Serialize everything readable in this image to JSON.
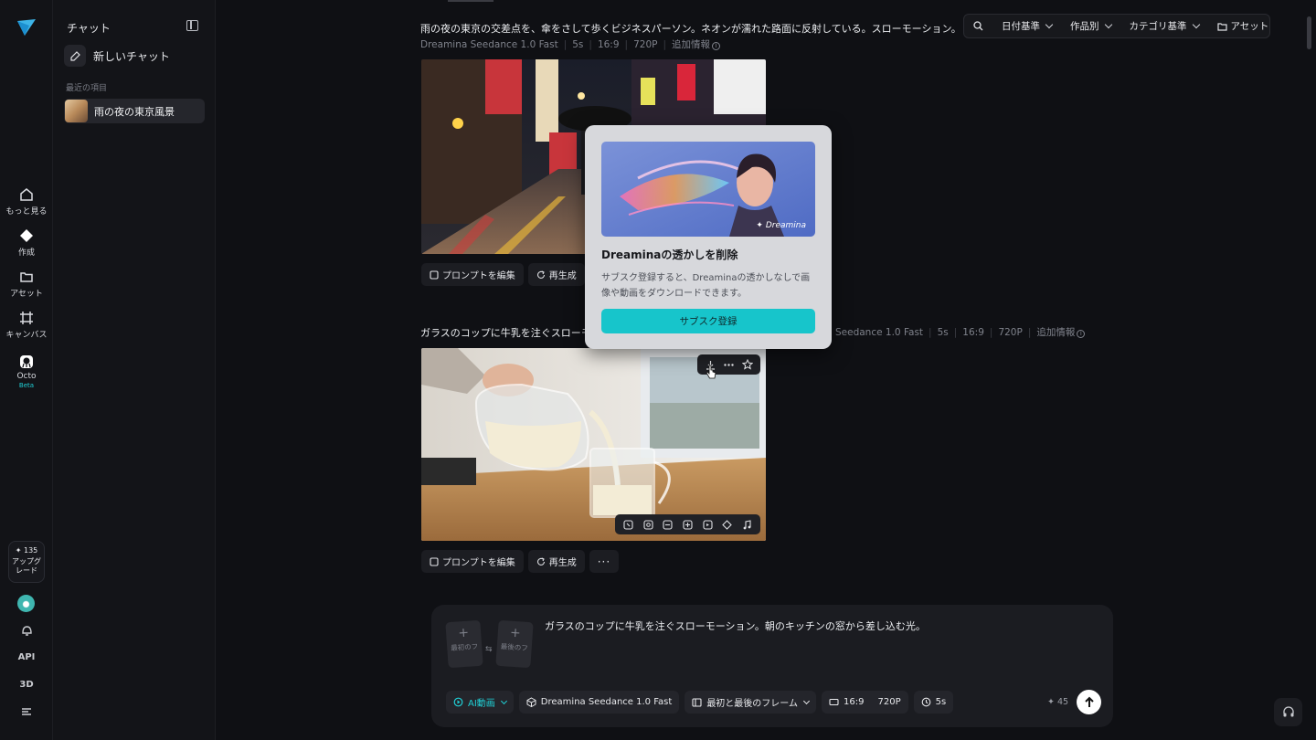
{
  "colors": {
    "accent": "#17c5cb",
    "background": "#0f1014",
    "panel": "#1b1c21"
  },
  "rail": {
    "items": [
      {
        "label": "もっと見る",
        "icon": "home-icon"
      },
      {
        "label": "作成",
        "icon": "create-icon"
      },
      {
        "label": "アセット",
        "icon": "folder-icon"
      },
      {
        "label": "キャンバス",
        "icon": "canvas-icon"
      },
      {
        "label": "Octo",
        "icon": "octo-icon",
        "badge": "Beta"
      }
    ],
    "credits": "135",
    "upgrade_label": "アップグレード",
    "api_label": "API",
    "three_d_label": "3D"
  },
  "sidebar": {
    "title": "チャット",
    "new_chat": "新しいチャット",
    "section": "最近の項目",
    "recent": [
      {
        "label": "雨の夜の東京風景"
      }
    ]
  },
  "toolbar": {
    "date": "日付基準",
    "by_work": "作品別",
    "category": "カテゴリ基準",
    "assets": "アセット"
  },
  "feed": [
    {
      "prompt": "雨の夜の東京の交差点を、傘をさして歩くビジネスパーソン。ネオンが濡れた路面に反射している。スローモーション。",
      "model": "Dreamina Seedance 1.0 Fast",
      "duration": "5s",
      "ratio": "16:9",
      "resolution": "720P",
      "more": "追加情報",
      "edit": "プロンプトを編集",
      "regen": "再生成"
    },
    {
      "prompt": "ガラスのコップに牛乳を注ぐスローモー",
      "model": "Seedance 1.0 Fast",
      "duration": "5s",
      "ratio": "16:9",
      "resolution": "720P",
      "more": "追加情報",
      "edit": "プロンプトを編集",
      "regen": "再生成",
      "more_actions": "···"
    }
  ],
  "popup": {
    "brand": "Dreamina",
    "title": "Dreaminaの透かしを削除",
    "body": "サブスク登録すると、Dreaminaの透かしなしで画像や動画をダウンロードできます。",
    "cta": "サブスク登録"
  },
  "composer": {
    "first_frame": "最初のフ",
    "last_frame": "最後のフ",
    "prompt": "ガラスのコップに牛乳を注ぐスローモーション。朝のキッチンの窓から差し込む光。",
    "mode": "AI動画",
    "model": "Dreamina Seedance 1.0 Fast",
    "frames": "最初と最後のフレーム",
    "ratio": "16:9",
    "resolution": "720P",
    "duration": "5s",
    "credits": "45"
  }
}
